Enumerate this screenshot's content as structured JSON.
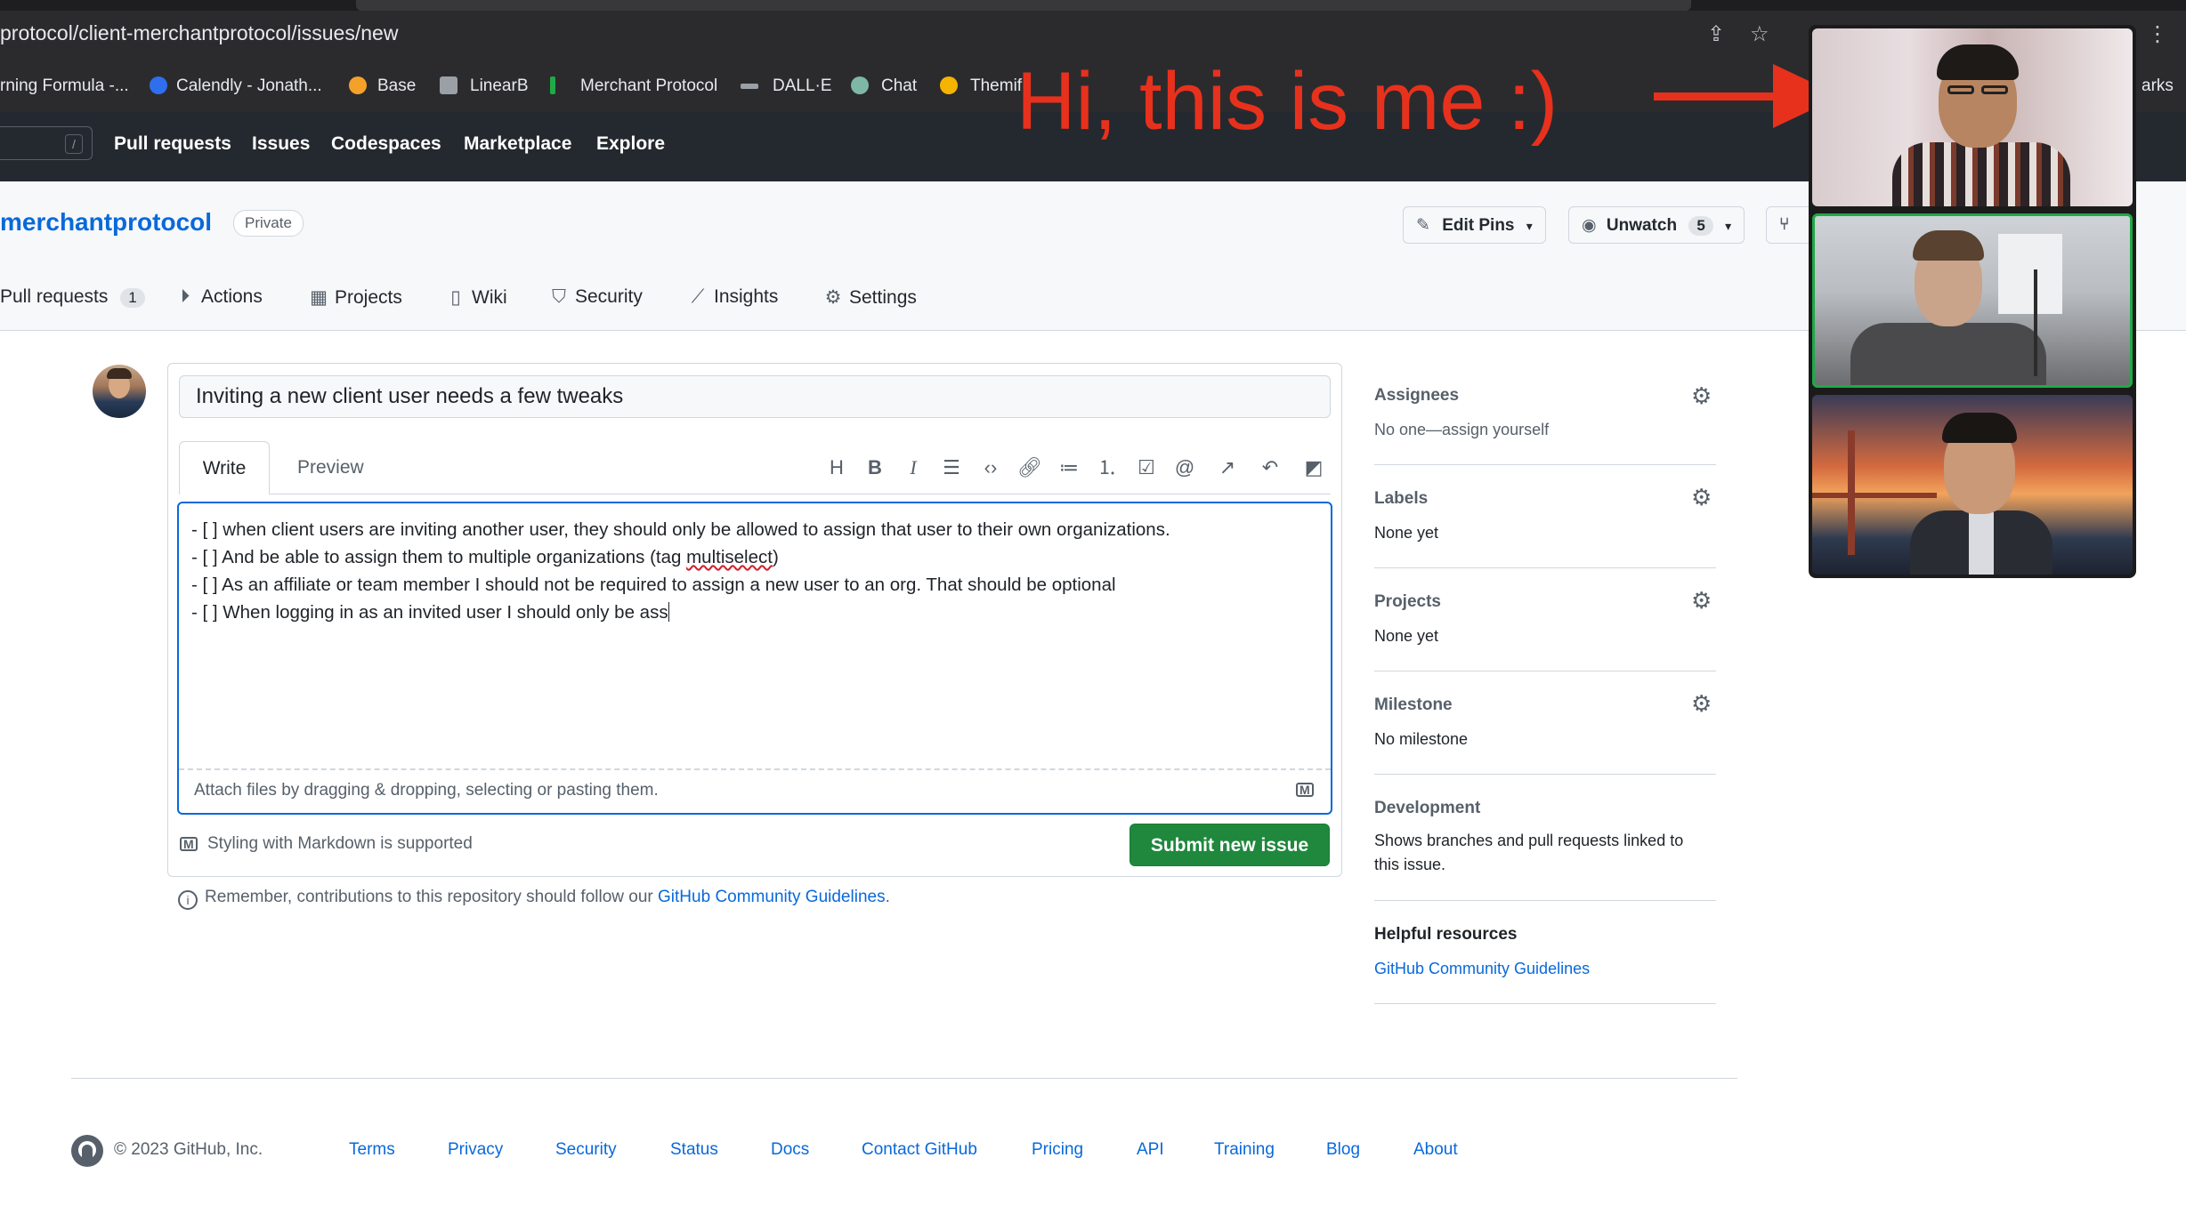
{
  "browser": {
    "url": "protocol/client-merchantprotocol/issues/new",
    "bookmarks": [
      {
        "label": "rning Formula -...",
        "color": "#2b2b2e"
      },
      {
        "label": "Calendly - Jonath...",
        "color": "#2f6fed"
      },
      {
        "label": "Base",
        "color": "#f4a12a"
      },
      {
        "label": "LinearB",
        "color": "#9aa0a6"
      },
      {
        "label": "Merchant Protocol",
        "color": "#1faa45"
      },
      {
        "label": "DALL·E",
        "color": "#9aa0a6"
      },
      {
        "label": "Chat",
        "color": "#7fb7a6"
      },
      {
        "label": "Themif",
        "color": "#f4b400"
      }
    ],
    "bookmarks_overflow": "arks"
  },
  "gh_header": {
    "slash_key": "/",
    "nav": [
      "Pull requests",
      "Issues",
      "Codespaces",
      "Marketplace",
      "Explore"
    ]
  },
  "repo": {
    "name": "merchantprotocol",
    "visibility": "Private",
    "edit_pins": "Edit Pins",
    "unwatch": "Unwatch",
    "unwatch_count": "5",
    "tabs": [
      {
        "label": "Pull requests",
        "count": "1",
        "icon": "pull-request-icon"
      },
      {
        "label": "Actions",
        "icon": "play-icon"
      },
      {
        "label": "Projects",
        "icon": "table-icon"
      },
      {
        "label": "Wiki",
        "icon": "book-icon"
      },
      {
        "label": "Security",
        "icon": "shield-icon"
      },
      {
        "label": "Insights",
        "icon": "graph-icon"
      },
      {
        "label": "Settings",
        "icon": "gear-icon"
      }
    ]
  },
  "issue_form": {
    "title_value": "Inviting a new client user needs a few tweaks",
    "tab_write": "Write",
    "tab_preview": "Preview",
    "body_lines": [
      "- [ ] when client users are inviting another user, they should only be allowed to assign that user to their own organizations.",
      "- [ ] And be able to assign them to multiple organizations (tag ",
      "- [ ] As an affiliate or team member I should not be required to assign a new user to an org. That should be optional",
      "- [ ] When logging in as an invited user I should only be ass"
    ],
    "body_line2_misspelled": "multiselect",
    "body_line2_end": ")",
    "attach_hint": "Attach files by dragging & dropping, selecting or pasting them.",
    "markdown_note": "Styling with Markdown is supported",
    "submit_label": "Submit new issue",
    "remember_text": "Remember, contributions to this repository should follow our ",
    "remember_link": "GitHub Community Guidelines",
    "remember_end": "."
  },
  "sidebar": {
    "assignees_label": "Assignees",
    "assignees_value": "No one—",
    "assign_yourself": "assign yourself",
    "labels_label": "Labels",
    "labels_value": "None yet",
    "projects_label": "Projects",
    "projects_value": "None yet",
    "milestone_label": "Milestone",
    "milestone_value": "No milestone",
    "development_label": "Development",
    "development_value": "Shows branches and pull requests linked to this issue.",
    "helpful_label": "Helpful resources",
    "helpful_link": "GitHub Community Guidelines"
  },
  "footer": {
    "copyright": "© 2023 GitHub, Inc.",
    "links": [
      "Terms",
      "Privacy",
      "Security",
      "Status",
      "Docs",
      "Contact GitHub",
      "Pricing",
      "API",
      "Training",
      "Blog",
      "About"
    ]
  },
  "overlay": {
    "caption": "Hi, this is me :)",
    "caption_color": "#e8311c",
    "active_speaker_color": "#1faa45"
  }
}
